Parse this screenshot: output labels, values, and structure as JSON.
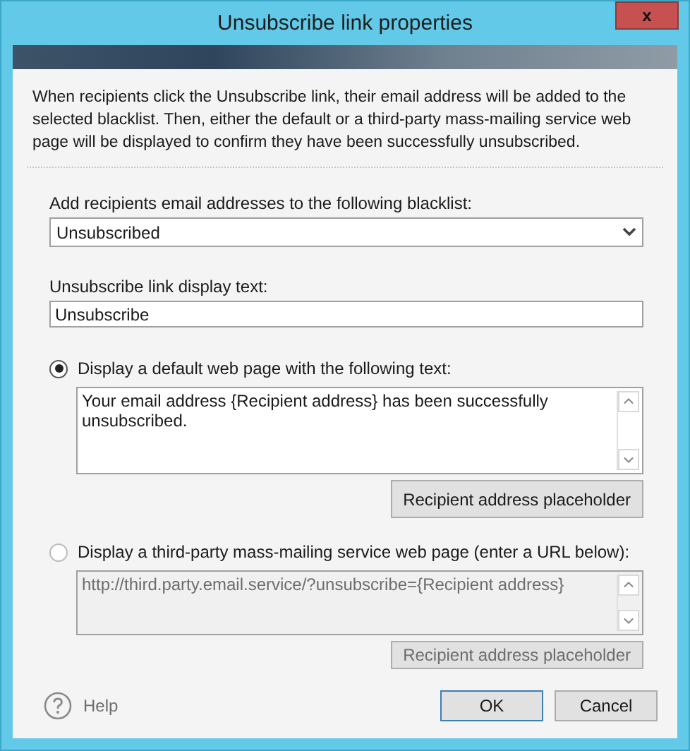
{
  "window": {
    "title": "Unsubscribe link properties",
    "close": "x"
  },
  "intro": "When recipients click the Unsubscribe link, their email address will be added to the selected blacklist. Then, either the default or a third-party mass-mailing service web page will be displayed to confirm they have been successfully unsubscribed.",
  "blacklist": {
    "label": "Add recipients email addresses to the following blacklist:",
    "value": "Unsubscribed"
  },
  "link_text": {
    "label": "Unsubscribe link display text:",
    "value": "Unsubscribe"
  },
  "options": [
    {
      "label": "Display a default web page with the following text:",
      "selected": true,
      "disabled": false,
      "text": "Your email address {Recipient address} has been successfully unsubscribed.",
      "button": "Recipient address placeholder"
    },
    {
      "label": "Display a third-party mass-mailing service web page (enter a URL below):",
      "selected": false,
      "disabled": true,
      "text": "http://third.party.email.service/?unsubscribe={Recipient address}",
      "button": "Recipient address placeholder"
    }
  ],
  "help": "Help",
  "buttons": [
    {
      "label": "OK",
      "default": true
    },
    {
      "label": "Cancel",
      "default": false
    }
  ]
}
